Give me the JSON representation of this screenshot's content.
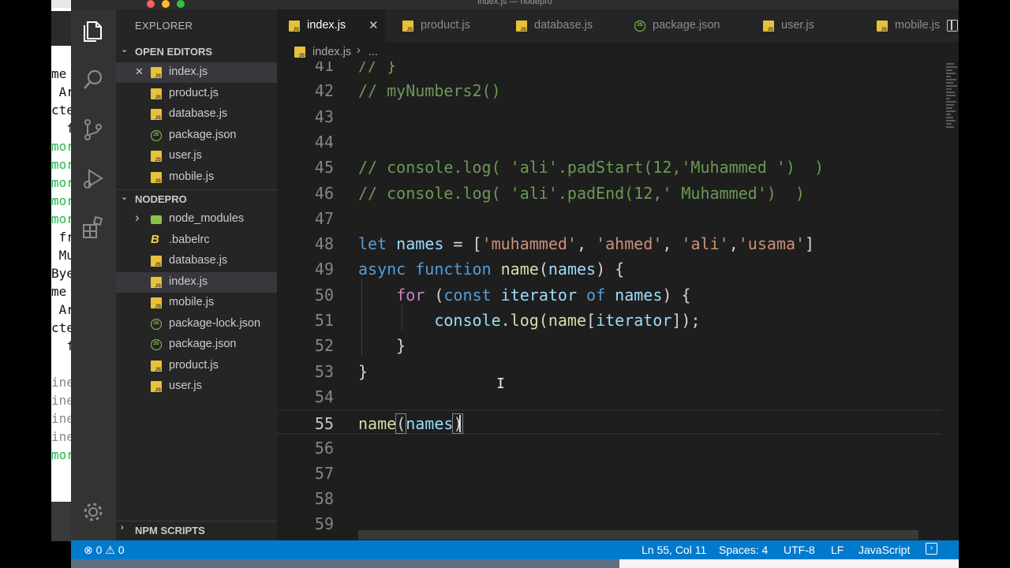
{
  "window": {
    "title": "index.js — nodepro"
  },
  "colors": {
    "accent": "#007acc",
    "editor_bg": "#1e1e1e",
    "sidebar_bg": "#252526"
  },
  "background_terminal": {
    "lines": [
      "me",
      " Ar",
      "cte",
      "  f",
      "mor",
      "mor",
      "mor",
      "mor",
      "mor",
      " fr",
      " Mu",
      "Bye",
      "me",
      " Ar",
      "cte",
      "  f",
      "",
      "ine",
      "ine",
      "ine",
      "ine",
      "mor"
    ]
  },
  "activity_bar": {
    "icons": [
      "files-icon",
      "search-icon",
      "source-control-icon",
      "debug-icon",
      "extensions-icon",
      "gear-icon"
    ]
  },
  "sidebar": {
    "title": "EXPLORER",
    "open_editors": {
      "label": "OPEN EDITORS",
      "items": [
        {
          "name": "index.js",
          "type": "js"
        },
        {
          "name": "product.js",
          "type": "js"
        },
        {
          "name": "database.js",
          "type": "js"
        },
        {
          "name": "package.json",
          "type": "json"
        },
        {
          "name": "user.js",
          "type": "js"
        },
        {
          "name": "mobile.js",
          "type": "js"
        }
      ]
    },
    "project": {
      "label": "NODEPRO",
      "items": [
        {
          "name": "node_modules",
          "type": "folder"
        },
        {
          "name": ".babelrc",
          "type": "babel"
        },
        {
          "name": "database.js",
          "type": "js"
        },
        {
          "name": "index.js",
          "type": "js"
        },
        {
          "name": "mobile.js",
          "type": "js"
        },
        {
          "name": "package-lock.json",
          "type": "json"
        },
        {
          "name": "package.json",
          "type": "json"
        },
        {
          "name": "product.js",
          "type": "js"
        },
        {
          "name": "user.js",
          "type": "js"
        }
      ]
    },
    "npm_scripts": {
      "label": "NPM SCRIPTS"
    }
  },
  "tabs": [
    {
      "name": "index.js",
      "type": "js",
      "active": true
    },
    {
      "name": "product.js",
      "type": "js"
    },
    {
      "name": "database.js",
      "type": "js"
    },
    {
      "name": "package.json",
      "type": "json"
    },
    {
      "name": "user.js",
      "type": "js"
    },
    {
      "name": "mobile.js",
      "type": "js"
    }
  ],
  "breadcrumb": {
    "file": "index.js",
    "separator": "›",
    "rest": "..."
  },
  "editor": {
    "current_line": 55,
    "lines": [
      {
        "n": "41",
        "tokens": [
          [
            "c-com",
            "// }"
          ]
        ]
      },
      {
        "n": "42",
        "tokens": [
          [
            "c-com",
            "// myNumbers2()"
          ]
        ]
      },
      {
        "n": "43",
        "tokens": []
      },
      {
        "n": "44",
        "tokens": []
      },
      {
        "n": "45",
        "tokens": [
          [
            "c-com",
            "// console.log( 'ali'.padStart(12,'Muhammed ')  )"
          ]
        ]
      },
      {
        "n": "46",
        "tokens": [
          [
            "c-com",
            "// console.log( 'ali'.padEnd(12,' Muhammed')  )"
          ]
        ]
      },
      {
        "n": "47",
        "tokens": []
      },
      {
        "n": "48",
        "tokens": [
          [
            "c-kw",
            "let"
          ],
          [
            "c-pun",
            " "
          ],
          [
            "c-var",
            "names"
          ],
          [
            "c-pun",
            " = ["
          ],
          [
            "c-str",
            "'muhammed'"
          ],
          [
            "c-pun",
            ", "
          ],
          [
            "c-str",
            "'ahmed'"
          ],
          [
            "c-pun",
            ", "
          ],
          [
            "c-str",
            "'ali'"
          ],
          [
            "c-pun",
            ","
          ],
          [
            "c-str",
            "'usama'"
          ],
          [
            "c-pun",
            "]"
          ]
        ]
      },
      {
        "n": "49",
        "tokens": [
          [
            "c-kw",
            "async"
          ],
          [
            "c-pun",
            " "
          ],
          [
            "c-kw",
            "function"
          ],
          [
            "c-pun",
            " "
          ],
          [
            "c-fn",
            "name"
          ],
          [
            "c-pun",
            "("
          ],
          [
            "c-var",
            "names"
          ],
          [
            "c-pun",
            ") {"
          ]
        ]
      },
      {
        "n": "50",
        "tokens": [
          [
            "c-pun",
            "    "
          ],
          [
            "c-ctl",
            "for"
          ],
          [
            "c-pun",
            " ("
          ],
          [
            "c-kw",
            "const"
          ],
          [
            "c-pun",
            " "
          ],
          [
            "c-var",
            "iterator"
          ],
          [
            "c-pun",
            " "
          ],
          [
            "c-kw",
            "of"
          ],
          [
            "c-pun",
            " "
          ],
          [
            "c-var",
            "names"
          ],
          [
            "c-pun",
            ") {"
          ]
        ]
      },
      {
        "n": "51",
        "tokens": [
          [
            "c-pun",
            "        "
          ],
          [
            "c-var",
            "console"
          ],
          [
            "c-pun",
            "."
          ],
          [
            "c-fn",
            "log"
          ],
          [
            "c-pun",
            "("
          ],
          [
            "c-fn",
            "name"
          ],
          [
            "c-pun",
            "["
          ],
          [
            "c-var",
            "iterator"
          ],
          [
            "c-pun",
            "]);"
          ]
        ]
      },
      {
        "n": "52",
        "tokens": [
          [
            "c-pun",
            "    }"
          ]
        ]
      },
      {
        "n": "53",
        "tokens": [
          [
            "c-pun",
            "}"
          ]
        ]
      },
      {
        "n": "54",
        "tokens": []
      },
      {
        "n": "55",
        "tokens": [
          [
            "c-fn",
            "name"
          ],
          [
            "c-pun bracket-box",
            "("
          ],
          [
            "c-var",
            "names"
          ],
          [
            "c-pun bracket-box",
            ")"
          ]
        ]
      },
      {
        "n": "56",
        "tokens": []
      },
      {
        "n": "57",
        "tokens": []
      },
      {
        "n": "58",
        "tokens": []
      },
      {
        "n": "59",
        "tokens": []
      }
    ]
  },
  "statusbar": {
    "errors": "0",
    "warnings": "0",
    "position": "Ln 55, Col 11",
    "spaces": "Spaces: 4",
    "encoding": "UTF-8",
    "eol": "LF",
    "language": "JavaScript"
  }
}
